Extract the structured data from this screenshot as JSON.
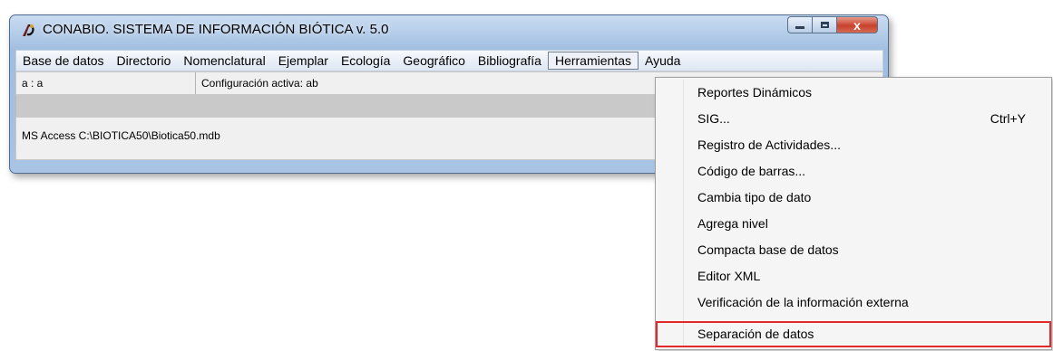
{
  "window": {
    "title": "CONABIO. SISTEMA DE INFORMACIÓN BIÓTICA v. 5.0",
    "close_symbol": "x",
    "icons": [
      "app-icon",
      "minimize-icon",
      "maximize-icon",
      "close-icon"
    ]
  },
  "menubar": {
    "items": [
      {
        "label": "Base de datos"
      },
      {
        "label": "Directorio"
      },
      {
        "label": "Nomenclatural"
      },
      {
        "label": "Ejemplar"
      },
      {
        "label": "Ecología"
      },
      {
        "label": "Geográfico"
      },
      {
        "label": "Bibliografía"
      },
      {
        "label": "Herramientas"
      },
      {
        "label": "Ayuda"
      }
    ],
    "open_item": "Herramientas"
  },
  "status": {
    "user": "a : a",
    "config": "Configuración activa: ab",
    "database": "MS Access  C:\\BIOTICA50\\Biotica50.mdb"
  },
  "herramientas_menu": {
    "items": [
      {
        "label": "Reportes Dinámicos",
        "shortcut": ""
      },
      {
        "label": "SIG...",
        "shortcut": "Ctrl+Y"
      },
      {
        "label": "Registro de Actividades...",
        "shortcut": ""
      },
      {
        "label": "Código de barras...",
        "shortcut": ""
      },
      {
        "label": "Cambia tipo de dato",
        "shortcut": ""
      },
      {
        "label": "Agrega nivel",
        "shortcut": ""
      },
      {
        "label": "Compacta base de datos",
        "shortcut": ""
      },
      {
        "label": "Editor XML",
        "shortcut": ""
      },
      {
        "label": "Verificación de la información externa",
        "shortcut": ""
      },
      {
        "label": "Separación de datos",
        "shortcut": ""
      }
    ],
    "highlighted_item": "Separación de datos",
    "highlight_color": "#e2282b"
  }
}
